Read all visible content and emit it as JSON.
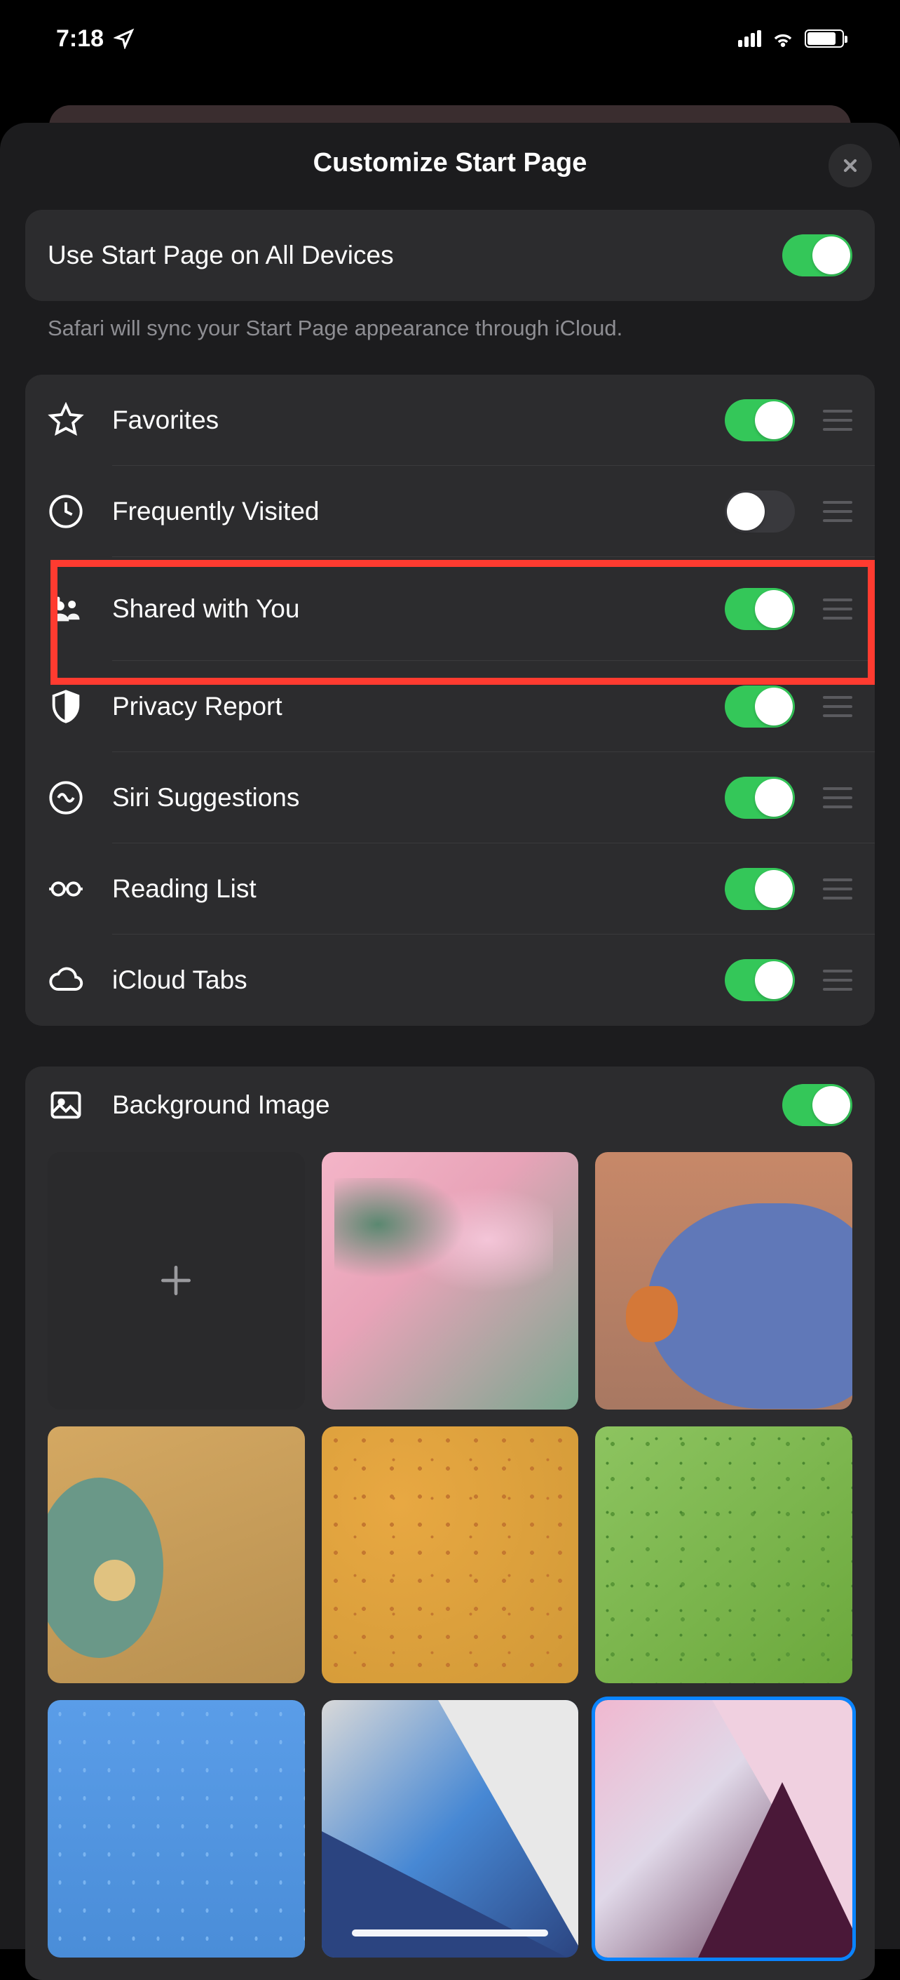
{
  "status": {
    "time": "7:18"
  },
  "sheet": {
    "title": "Customize Start Page",
    "sync_row": {
      "label": "Use Start Page on All Devices",
      "enabled": true
    },
    "sync_footer": "Safari will sync your Start Page appearance through iCloud.",
    "items": [
      {
        "icon": "star",
        "label": "Favorites",
        "enabled": true,
        "highlighted": false
      },
      {
        "icon": "clock",
        "label": "Frequently Visited",
        "enabled": false,
        "highlighted": false
      },
      {
        "icon": "shared",
        "label": "Shared with You",
        "enabled": true,
        "highlighted": true
      },
      {
        "icon": "shield",
        "label": "Privacy Report",
        "enabled": true,
        "highlighted": false
      },
      {
        "icon": "siri",
        "label": "Siri Suggestions",
        "enabled": true,
        "highlighted": false
      },
      {
        "icon": "glasses",
        "label": "Reading List",
        "enabled": true,
        "highlighted": false
      },
      {
        "icon": "cloud",
        "label": "iCloud Tabs",
        "enabled": true,
        "highlighted": false
      }
    ],
    "background": {
      "label": "Background Image",
      "enabled": true
    }
  }
}
